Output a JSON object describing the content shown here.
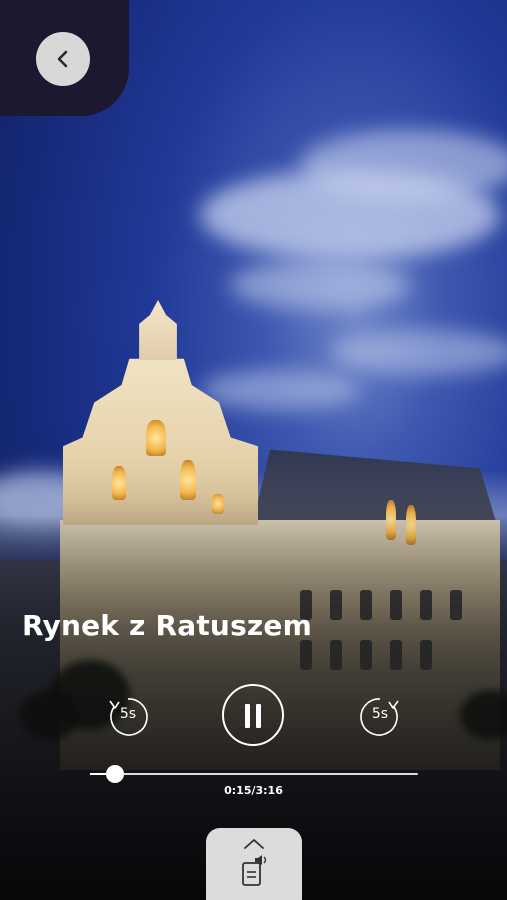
{
  "screen": {
    "background_description": "night-photo-town-hall",
    "accent_color": "#ffffff",
    "panel_color": "#1c1830",
    "button_color": "#d8d8d8"
  },
  "header": {
    "back_icon": "chevron-left-icon"
  },
  "player": {
    "title": "Rynek z Ratuszem",
    "rewind_label": "5s",
    "forward_label": "5s",
    "rewind_icon": "rewind-5s-icon",
    "forward_icon": "forward-5s-icon",
    "pause_icon": "pause-icon",
    "time": "0:15/3:16",
    "progress_fraction": 0.0765
  },
  "bottom_tab": {
    "chevron_icon": "chevron-up-icon",
    "doc_icon": "audio-document-icon"
  }
}
